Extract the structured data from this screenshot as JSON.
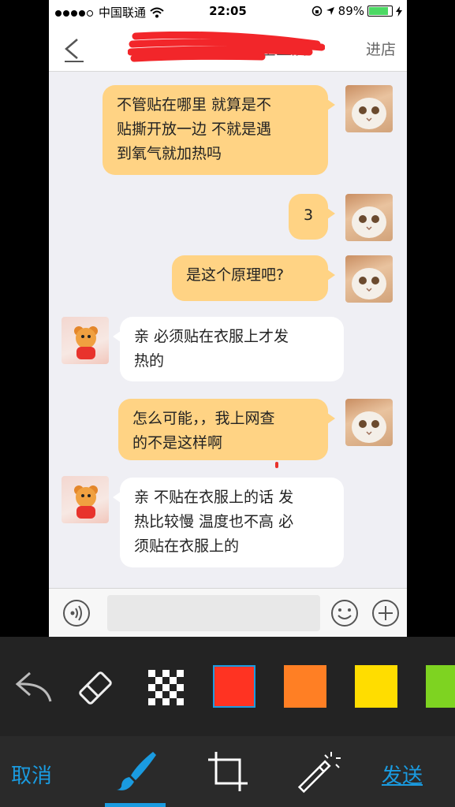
{
  "status_bar": {
    "carrier": "中国联通",
    "time": "22:05",
    "battery": "89%",
    "battery_level": 0.89
  },
  "nav": {
    "title_visible_fragment": "…業企业店",
    "shop_label": "进店"
  },
  "messages": [
    {
      "side": "out",
      "text_lines": [
        "不管贴在哪里 就算是不",
        "贴撕开放一边 不就是遇",
        "到氧气就加热吗"
      ]
    },
    {
      "side": "out",
      "text_lines": [
        "3"
      ]
    },
    {
      "side": "out",
      "text_lines": [
        "是这个原理吧?"
      ]
    },
    {
      "side": "in",
      "text_lines": [
        "亲 必须贴在衣服上才发",
        "热的"
      ]
    },
    {
      "side": "out",
      "text_lines": [
        "怎么可能，，我上网查",
        "的不是这样啊"
      ]
    },
    {
      "side": "in",
      "text_lines": [
        "亲 不贴在衣服上的话 发",
        "热比较慢 温度也不高 必",
        "须贴在衣服上的"
      ]
    }
  ],
  "input": {
    "placeholder": ""
  },
  "editor": {
    "colors": {
      "red": "#ff3322",
      "orange": "#ff7f24",
      "yellow": "#ffdd00",
      "green": "#7ed321",
      "accent": "#1a9be0"
    },
    "cancel_label": "取消",
    "send_label": "发送",
    "icons": [
      "undo-icon",
      "eraser-icon",
      "mosaic-icon",
      "brush-icon",
      "crop-icon",
      "magic-wand-icon"
    ]
  }
}
